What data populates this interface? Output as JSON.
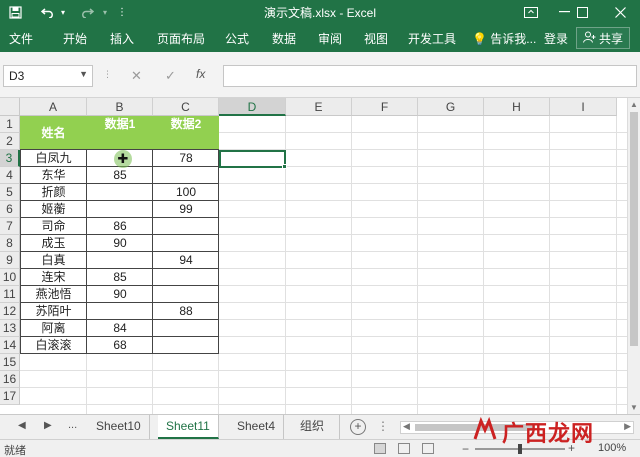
{
  "window": {
    "title": "演示文稿.xlsx - Excel",
    "min_icon": "minimize-icon",
    "max_icon": "maximize-icon",
    "close_icon": "close-icon"
  },
  "quick_access": [
    {
      "name": "save-icon"
    },
    {
      "name": "undo-icon"
    },
    {
      "name": "redo-icon"
    },
    {
      "name": "customize-qat-icon"
    }
  ],
  "ribbon": {
    "tabs": [
      "文件",
      "开始",
      "插入",
      "页面布局",
      "公式",
      "数据",
      "审阅",
      "视图",
      "开发工具"
    ],
    "tell_me": "告诉我...",
    "login": "登录",
    "share": "共享"
  },
  "formula_bar": {
    "name_box": "D3",
    "cancel": "✕",
    "enter": "✓",
    "fx": "fx",
    "formula": ""
  },
  "columns": [
    "A",
    "B",
    "C",
    "D",
    "E",
    "F",
    "G",
    "H",
    "I"
  ],
  "rows": [
    "1",
    "2",
    "3",
    "4",
    "5",
    "6",
    "7",
    "8",
    "9",
    "10",
    "11",
    "12",
    "13",
    "14",
    "15",
    "16",
    "17"
  ],
  "selected_cell": "D3",
  "table": {
    "header": [
      "姓名",
      "数据1",
      "数据2"
    ],
    "rows": [
      [
        "白凤九",
        "",
        "78"
      ],
      [
        "东华",
        "85",
        ""
      ],
      [
        "折颜",
        "",
        "100"
      ],
      [
        "姬蘅",
        "",
        "99"
      ],
      [
        "司命",
        "86",
        ""
      ],
      [
        "成玉",
        "90",
        ""
      ],
      [
        "白真",
        "",
        "94"
      ],
      [
        "连宋",
        "85",
        ""
      ],
      [
        "燕池悟",
        "90",
        ""
      ],
      [
        "苏陌叶",
        "",
        "88"
      ],
      [
        "阿离",
        "84",
        ""
      ],
      [
        "白滚滚",
        "68",
        ""
      ]
    ]
  },
  "sheet_tabs": {
    "nav_prev": "◀",
    "nav_next": "▶",
    "nav_more": "...",
    "tabs": [
      "Sheet10",
      "Sheet11",
      "Sheet4",
      "组织"
    ],
    "active": "Sheet11",
    "add": "+"
  },
  "status": {
    "ready": "就绪",
    "zoom": "100%",
    "zoom_minus": "−",
    "zoom_plus": "+"
  },
  "watermark": {
    "text": "广西龙网"
  },
  "colors": {
    "excel_green": "#217346",
    "header_fill": "#92d050"
  }
}
